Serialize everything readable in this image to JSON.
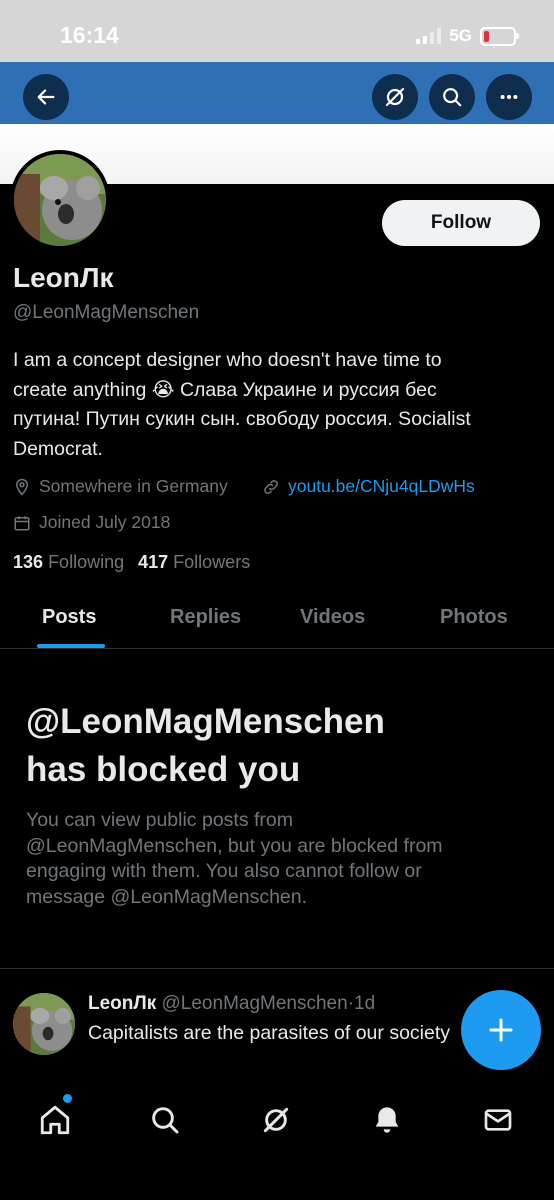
{
  "status_bar": {
    "time": "16:14",
    "network": "5G"
  },
  "header": {
    "back_icon": "arrow-left-icon",
    "grok_icon": "grok-icon",
    "search_icon": "search-icon",
    "more_icon": "more-horizontal-icon"
  },
  "profile": {
    "display_name": "LeonЛк",
    "handle": "@LeonMagMenschen",
    "follow_label": "Follow",
    "bio_lines": [
      "I am a concept designer who doesn't have time to",
      "create anything 😭 Слава Украине и руссия бес",
      "путина! Путин сукин сын. свободу россия. Socialist",
      "Democrat."
    ],
    "location": "Somewhere in Germany",
    "website": "youtu.be/CNju4qLDwHs",
    "joined": "Joined July 2018",
    "following_count": "136",
    "following_label": "Following",
    "followers_count": "417",
    "followers_label": "Followers"
  },
  "tabs": [
    {
      "label": "Posts",
      "active": true
    },
    {
      "label": "Replies",
      "active": false
    },
    {
      "label": "Videos",
      "active": false
    },
    {
      "label": "Photos",
      "active": false
    }
  ],
  "blocked": {
    "title_line1": "@LeonMagMenschen",
    "title_line2": "has blocked you",
    "body_lines": [
      "You can view public posts from",
      "@LeonMagMenschen, but you are blocked from",
      "engaging with them. You also cannot follow or",
      "message @LeonMagMenschen."
    ]
  },
  "post": {
    "name": "LeonЛк",
    "handle": "@LeonMagMenschen",
    "separator": "·",
    "time": "1d",
    "text": "Capitalists are the parasites of our society"
  },
  "colors": {
    "accent": "#1d9bf0",
    "banner": "#2f6fb6",
    "background": "#000000"
  },
  "bottom_nav": [
    "home-icon",
    "search-icon",
    "grok-icon",
    "notifications-bell-icon",
    "messages-mail-icon"
  ]
}
